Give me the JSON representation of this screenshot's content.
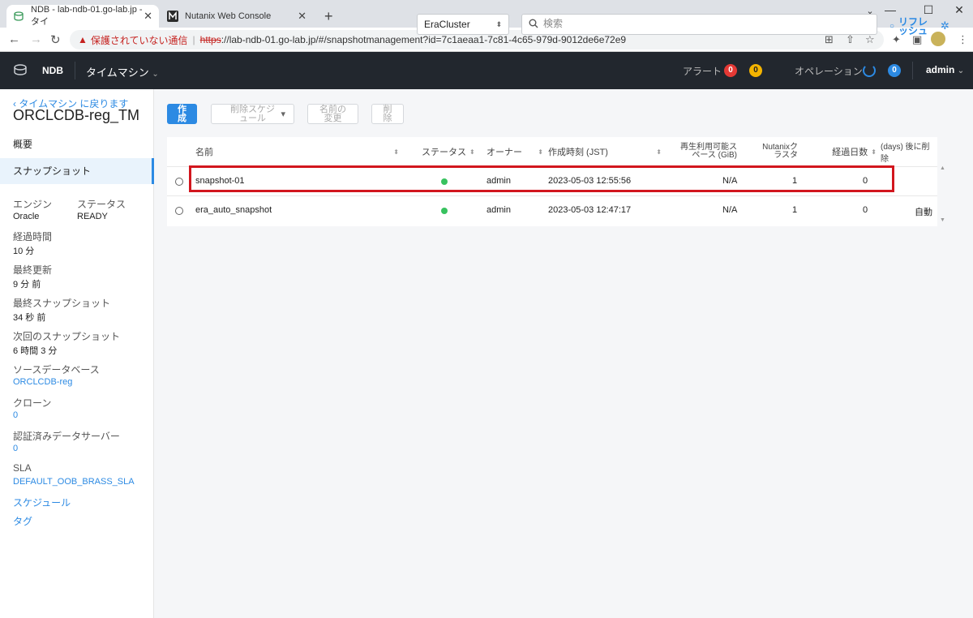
{
  "browser": {
    "tabs": [
      {
        "title": "NDB - lab-ndb-01.go-lab.jp - タイ"
      },
      {
        "title": "Nutanix Web Console"
      }
    ],
    "new_tab": "+",
    "close": "✕",
    "window_controls": {
      "min": "—",
      "max": "☐",
      "close": "✕"
    },
    "security_warning": "保護されていない通信",
    "url_separator": "|",
    "url_scheme": "https",
    "url_rest": "://lab-ndb-01.go-lab.jp/#/snapshotmanagement?id=7c1aeaa1-7c81-4c65-979d-9012de6e72e9"
  },
  "app": {
    "brand": "NDB",
    "menu": "タイムマシン",
    "alerts_label": "アラート",
    "alert_red": "0",
    "alert_yellow": "0",
    "operations_label": "オペレーション",
    "operations_count": "0",
    "user": "admin",
    "colors": {
      "header_bg": "#22272e",
      "accent": "#2c8ae3",
      "alert_red": "#e53935",
      "alert_yellow": "#f4b400",
      "highlight": "#d2161e",
      "status_ok": "#38c25f"
    }
  },
  "sidebar": {
    "back_label": "‹ タイムマシン に戻ります",
    "title": "ORCLCDB-reg_TM",
    "nav": [
      {
        "label": "概要"
      },
      {
        "label": "スナップショット"
      }
    ],
    "engine_label": "エンジン",
    "engine_value": "Oracle",
    "status_label": "ステータス",
    "status_value": "READY",
    "details": [
      {
        "label": "経過時間",
        "value": "10 分"
      },
      {
        "label": "最終更新",
        "value": "9 分 前"
      },
      {
        "label": "最終スナップショット",
        "value": "34 秒 前"
      },
      {
        "label": "次回のスナップショット",
        "value": "6 時間 3 分"
      },
      {
        "label": "ソースデータベース",
        "value": "ORCLCDB-reg"
      },
      {
        "label": "クローン",
        "value": "0"
      },
      {
        "label": "認証済みデータサーバー",
        "value": "0"
      },
      {
        "label": "SLA",
        "value": "DEFAULT_OOB_BRASS_SLA"
      }
    ],
    "links": [
      {
        "label": "スケジュール"
      },
      {
        "label": "タグ"
      }
    ]
  },
  "toolbar": {
    "create_line1": "作",
    "create_line2": "成",
    "schedule_line1": "削除スケジ",
    "schedule_line2": "ュール",
    "schedule_arrow": "▾",
    "rename_line1": "名前の",
    "rename_line2": "変更",
    "delete_line1": "削",
    "delete_line2": "除",
    "cluster": "EraCluster",
    "cluster_arrow": "⬍",
    "search_placeholder": "検索",
    "refresh_line1": "リフレ",
    "refresh_line2": "ッシュ",
    "refresh_icon": "○"
  },
  "table": {
    "headers": {
      "name": "名前",
      "status": "ステータス",
      "owner": "オーナー",
      "created": "作成時刻 (JST)",
      "space_line1": "再生利用可能ス",
      "space_line2": "ペース (GiB)",
      "cluster_line1": "Nutanixク",
      "cluster_line2": "ラスタ",
      "age": "経過日数",
      "delete_after": "(days) 後に削除"
    },
    "rows": [
      {
        "name": "snapshot-01",
        "owner": "admin",
        "created": "2023-05-03 12:55:56",
        "space": "N/A",
        "clusters": "1",
        "age": "0",
        "delete_after": ""
      },
      {
        "name": "era_auto_snapshot",
        "owner": "admin",
        "created": "2023-05-03 12:47:17",
        "space": "N/A",
        "clusters": "1",
        "age": "0",
        "delete_after": "自動"
      }
    ]
  }
}
